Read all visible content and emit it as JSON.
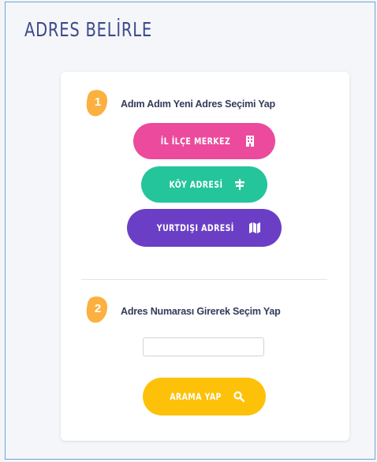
{
  "page": {
    "title": "ADRES BELİRLE"
  },
  "step1": {
    "number": "1",
    "label": "Adım Adım Yeni Adres Seçimi Yap",
    "buttons": [
      {
        "label": "İL İLÇE MERKEZ",
        "icon": "building-icon",
        "color": "#ec4a9c"
      },
      {
        "label": "KÖY ADRESİ",
        "icon": "signpost-icon",
        "color": "#24c59b"
      },
      {
        "label": "YURTDIŞI ADRESİ",
        "icon": "map-icon",
        "color": "#6b3fc5"
      }
    ]
  },
  "step2": {
    "number": "2",
    "label": "Adres Numarası Girerek Seçim Yap",
    "input": {
      "value": "",
      "placeholder": ""
    },
    "search_button": {
      "label": "ARAMA YAP",
      "icon": "search-icon",
      "color": "#fdc10a"
    }
  },
  "colors": {
    "badge": "#fbb040",
    "title": "#3d4a8a"
  }
}
